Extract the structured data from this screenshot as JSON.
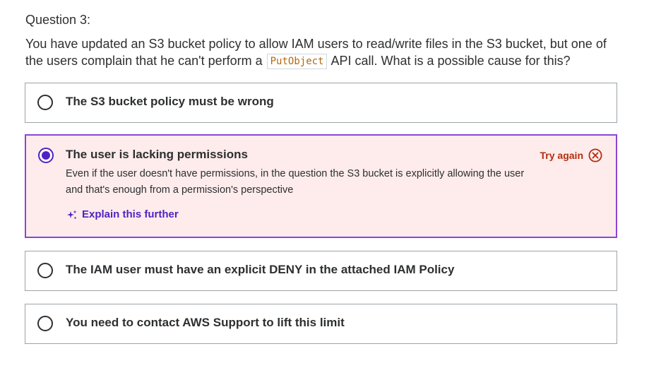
{
  "question": {
    "number_label": "Question 3:",
    "text_before": "You have updated an S3 bucket policy to allow IAM users to read/write files in the S3 bucket, but one of the users complain that he can't perform a ",
    "code": "PutObject",
    "text_after": " API call. What is a possible cause for this?"
  },
  "options": [
    {
      "label": "The S3 bucket policy must be wrong",
      "selected": false
    },
    {
      "label": "The user is lacking permissions",
      "selected": true,
      "status": "Try again",
      "explanation": "Even if the user doesn't have permissions, in the question the S3 bucket is explicitly allowing the user and that's enough from a permission's perspective",
      "explain_link": "Explain this further"
    },
    {
      "label": "The IAM user must have an explicit DENY in the attached IAM Policy",
      "selected": false
    },
    {
      "label": "You need to contact AWS Support to lift this limit",
      "selected": false
    }
  ],
  "colors": {
    "accent": "#5022c3",
    "selected_border": "#8a45d8",
    "selected_background": "#fdeceb",
    "error": "#b32d0f",
    "code_text": "#b4690e",
    "text": "#2d2f31"
  },
  "icons": {
    "radio_selected": "radio-filled-icon",
    "radio_unselected": "radio-empty-icon",
    "error": "circle-x-icon",
    "ai": "sparkle-icon"
  }
}
